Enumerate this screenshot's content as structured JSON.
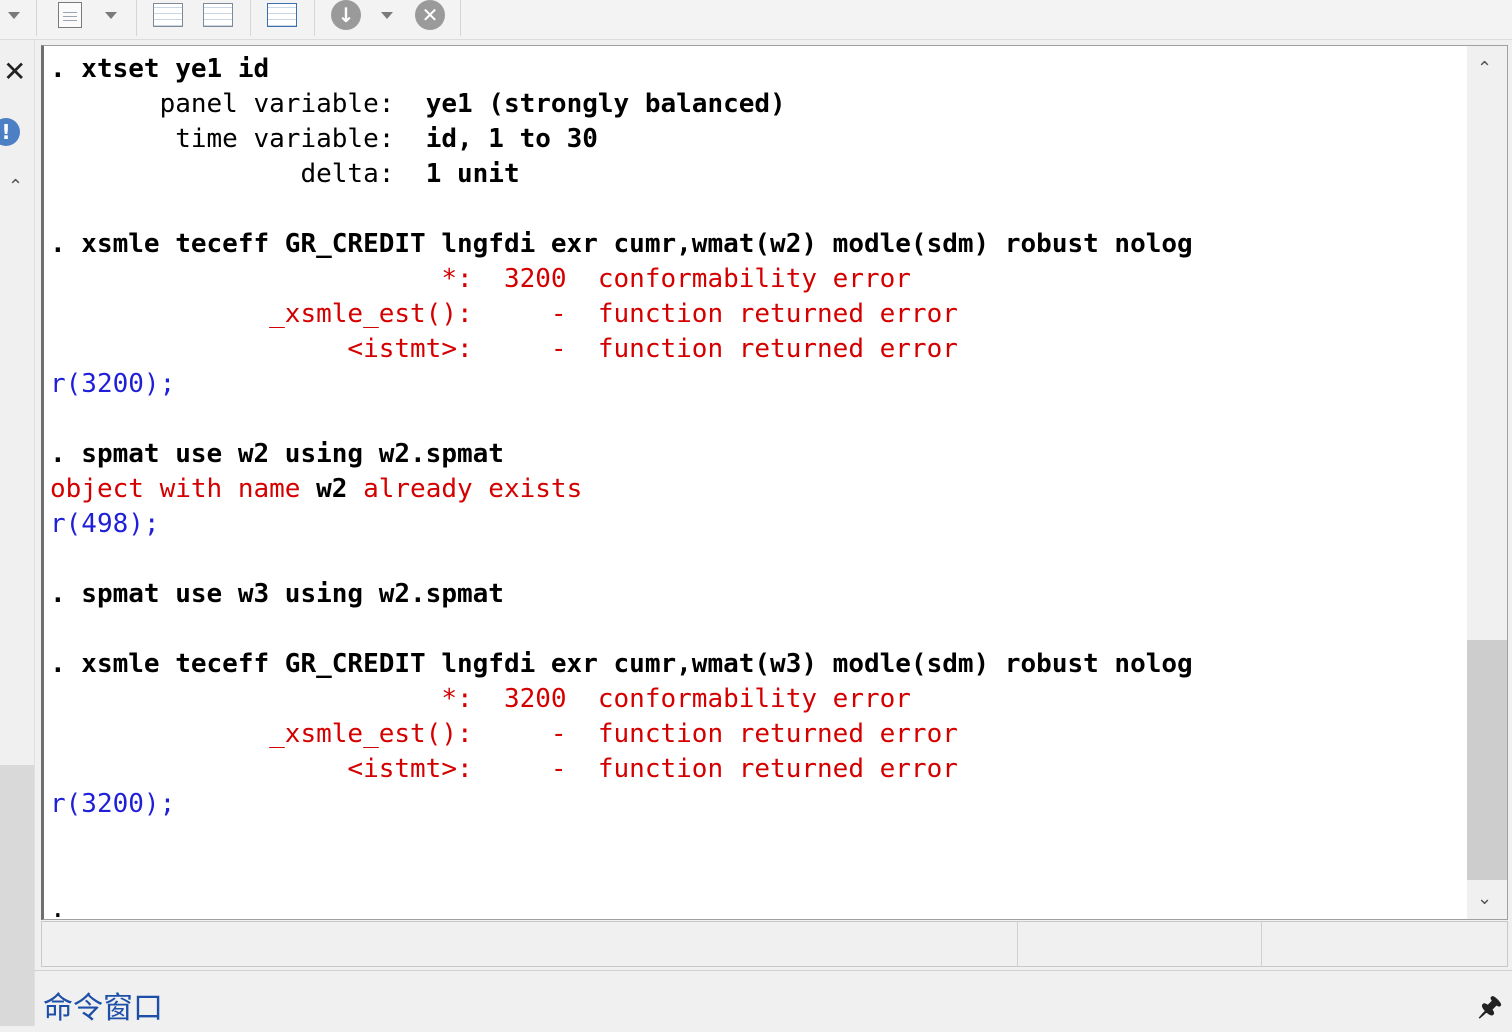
{
  "toolbar": {
    "buttons": [
      {
        "name": "dropdown-caret-icon"
      },
      {
        "name": "do-file-editor-icon"
      },
      {
        "name": "dropdown-caret-icon"
      },
      {
        "name": "data-editor-edit-icon"
      },
      {
        "name": "data-editor-browse-icon"
      },
      {
        "name": "variables-manager-icon"
      },
      {
        "name": "more-icon"
      },
      {
        "name": "dropdown-caret-icon"
      },
      {
        "name": "break-icon"
      }
    ]
  },
  "sidebar": {
    "close_glyph": "✕",
    "info_glyph": "!",
    "collapse_glyph": "⌃"
  },
  "results": {
    "lines": [
      {
        "segments": [
          {
            "t": ". xtset ye1 id",
            "c": "cmd"
          }
        ]
      },
      {
        "segments": [
          {
            "t": "       panel variable:  ",
            "c": "plain"
          },
          {
            "t": "ye1 (strongly balanced)",
            "c": "cmd"
          }
        ]
      },
      {
        "segments": [
          {
            "t": "        time variable:  ",
            "c": "plain"
          },
          {
            "t": "id, 1 to 30",
            "c": "cmd"
          }
        ]
      },
      {
        "segments": [
          {
            "t": "                delta:  ",
            "c": "plain"
          },
          {
            "t": "1 unit",
            "c": "cmd"
          }
        ]
      },
      {
        "segments": []
      },
      {
        "segments": [
          {
            "t": ". xsmle teceff GR_CREDIT lngfdi exr cumr,wmat(w2) modle(sdm) robust nolog",
            "c": "cmd"
          }
        ]
      },
      {
        "segments": [
          {
            "t": "                         *:  3200  conformability error",
            "c": "err"
          }
        ]
      },
      {
        "segments": [
          {
            "t": "              _xsmle_est():     -  function returned error",
            "c": "err"
          }
        ]
      },
      {
        "segments": [
          {
            "t": "                   <istmt>:     -  function returned error",
            "c": "err"
          }
        ]
      },
      {
        "segments": [
          {
            "t": "r(3200);",
            "c": "rc"
          }
        ]
      },
      {
        "segments": []
      },
      {
        "segments": [
          {
            "t": ". spmat use w2 using w2.spmat",
            "c": "cmd"
          }
        ]
      },
      {
        "segments": [
          {
            "t": "object with name ",
            "c": "err"
          },
          {
            "t": "w2",
            "c": "cmd"
          },
          {
            "t": " already exists",
            "c": "err"
          }
        ]
      },
      {
        "segments": [
          {
            "t": "r(498);",
            "c": "rc"
          }
        ]
      },
      {
        "segments": []
      },
      {
        "segments": [
          {
            "t": ". spmat use w3 using w2.spmat",
            "c": "cmd"
          }
        ]
      },
      {
        "segments": []
      },
      {
        "segments": [
          {
            "t": ". xsmle teceff GR_CREDIT lngfdi exr cumr,wmat(w3) modle(sdm) robust nolog",
            "c": "cmd"
          }
        ]
      },
      {
        "segments": [
          {
            "t": "                         *:  3200  conformability error",
            "c": "err"
          }
        ]
      },
      {
        "segments": [
          {
            "t": "              _xsmle_est():     -  function returned error",
            "c": "err"
          }
        ]
      },
      {
        "segments": [
          {
            "t": "                   <istmt>:     -  function returned error",
            "c": "err"
          }
        ]
      },
      {
        "segments": [
          {
            "t": "r(3200);",
            "c": "rc"
          }
        ]
      },
      {
        "segments": []
      },
      {
        "segments": []
      },
      {
        "segments": [
          {
            "t": ".",
            "c": "plain"
          }
        ]
      }
    ],
    "scroll_up_glyph": "⌃",
    "scroll_down_glyph": "⌄"
  },
  "command_window": {
    "title": "命令窗口",
    "pin_glyph": "🖈"
  }
}
